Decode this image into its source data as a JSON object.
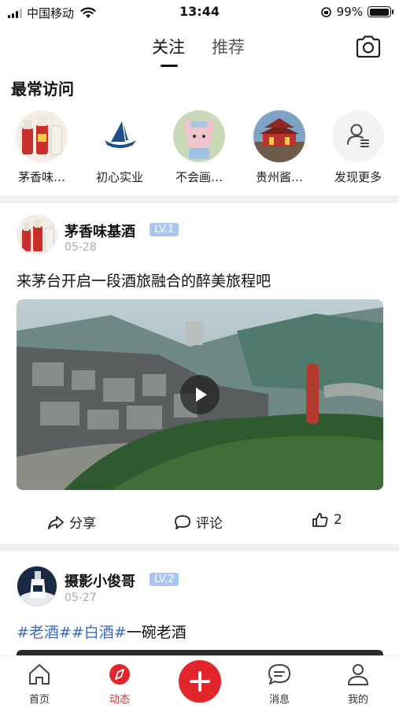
{
  "status_bar": {
    "carrier": "中国移动",
    "time": "13:44",
    "battery": "99%"
  },
  "top_tabs": {
    "follow": "关注",
    "recommend": "推荐",
    "active": "follow"
  },
  "most_visited": {
    "title": "最常访问",
    "items": [
      {
        "label": "茅香味…"
      },
      {
        "label": "初心实业"
      },
      {
        "label": "不会画…"
      },
      {
        "label": "贵州酱…"
      },
      {
        "label": "发现更多"
      }
    ]
  },
  "posts": [
    {
      "author": "茅香味基酒",
      "level": "LV.1",
      "date": "05-28",
      "text": "来茅台开启一段酒旅融合的醉美旅程吧",
      "actions": {
        "share": "分享",
        "comment": "评论",
        "like_count": "2"
      }
    },
    {
      "author": "摄影小俊哥",
      "level": "LV.2",
      "date": "05-27",
      "text_parts": [
        "#老酒#",
        "#白酒#",
        "一碗老酒"
      ]
    }
  ],
  "bottom_nav": {
    "items": [
      {
        "label": "首页"
      },
      {
        "label": "动态"
      },
      {
        "label": "消息"
      },
      {
        "label": "我的"
      }
    ],
    "active_index": 1
  },
  "colors": {
    "accent_red": "#e3262c",
    "hashtag_blue": "#3e6cb8",
    "level_badge": "#a9c6f0"
  }
}
